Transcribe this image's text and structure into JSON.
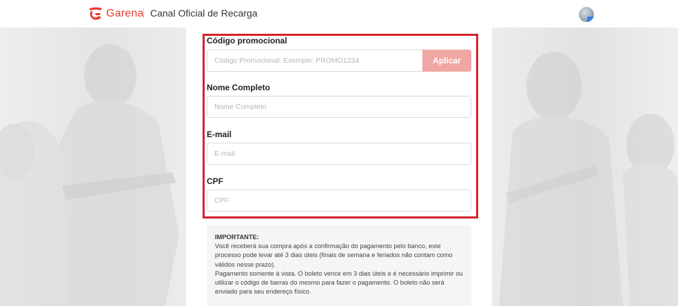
{
  "header": {
    "brand": "Garena",
    "title": "Canal Oficial de Recarga",
    "brand_color": "#e63b2e"
  },
  "form": {
    "promo": {
      "label": "Código promocional",
      "placeholder": "Código Promocional. Exemplo: PROMO1234",
      "value": "",
      "button_label": "Aplicar"
    },
    "name": {
      "label": "Nome Completo",
      "placeholder": "Nome Completo",
      "value": ""
    },
    "email": {
      "label": "E-mail",
      "placeholder": "E-mail",
      "value": ""
    },
    "cpf": {
      "label": "CPF",
      "placeholder": "CPF",
      "value": ""
    },
    "highlight_color": "#d2232a"
  },
  "notice": {
    "title": "IMPORTANTE:",
    "paragraph1": "Você receberá sua compra após a confirmação do pagamento pelo banco, este processo pode levar até 3 dias úteis (finais de semana e feriados não contam como válidos nesse prazo).",
    "paragraph2": "Pagamento somente à vista. O boleto vence em 3 dias úteis e é necessário imprimir ou utilizar o código de barras do mesmo para fazer o pagamento. O boleto não será enviado para seu endereço físico."
  },
  "icons": {
    "logo": "garena-logo-icon",
    "avatar": "user-avatar"
  }
}
